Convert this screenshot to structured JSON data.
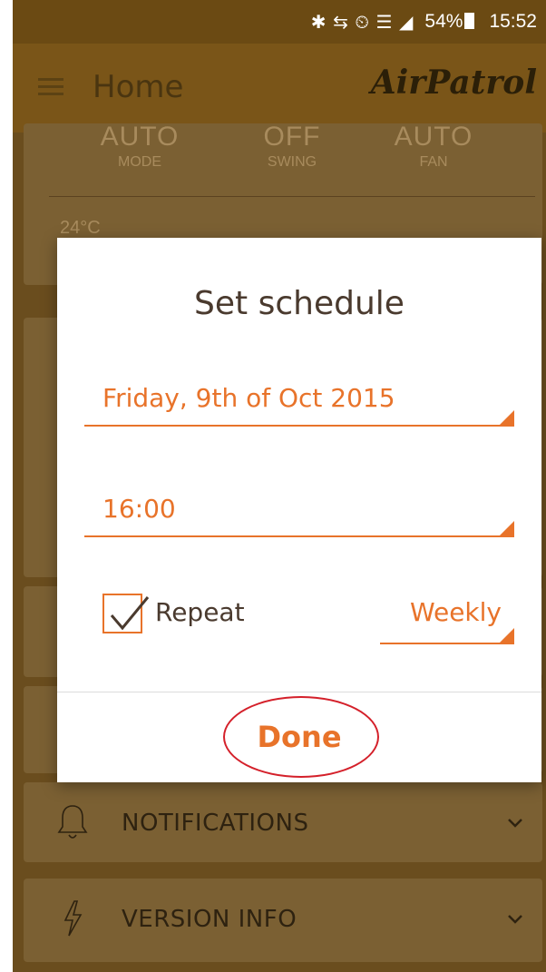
{
  "status_bar": {
    "icons": "✱ ⇆ ⏲ ☰ ◢",
    "battery": "54%",
    "time": "15:52"
  },
  "app_bar": {
    "title": "Home",
    "brand": "AirPatrol"
  },
  "ac_card": {
    "modes": [
      {
        "value": "AUTO",
        "label": "MODE"
      },
      {
        "value": "OFF",
        "label": "SWING"
      },
      {
        "value": "AUTO",
        "label": "FAN"
      }
    ],
    "temperature": "24°C"
  },
  "list_rows": [
    {
      "label": "NOTIFICATIONS",
      "icon": "bell-icon"
    },
    {
      "label": "VERSION INFO",
      "icon": "lightning-icon"
    }
  ],
  "dialog": {
    "title": "Set schedule",
    "date": "Friday, 9th of Oct 2015",
    "time": "16:00",
    "repeat_label": "Repeat",
    "repeat_checked": true,
    "frequency": "Weekly",
    "done_label": "Done"
  },
  "colors": {
    "accent": "#e8732a",
    "highlight_ring": "#d4202a",
    "dim_overlay": "#6a4d1e"
  }
}
